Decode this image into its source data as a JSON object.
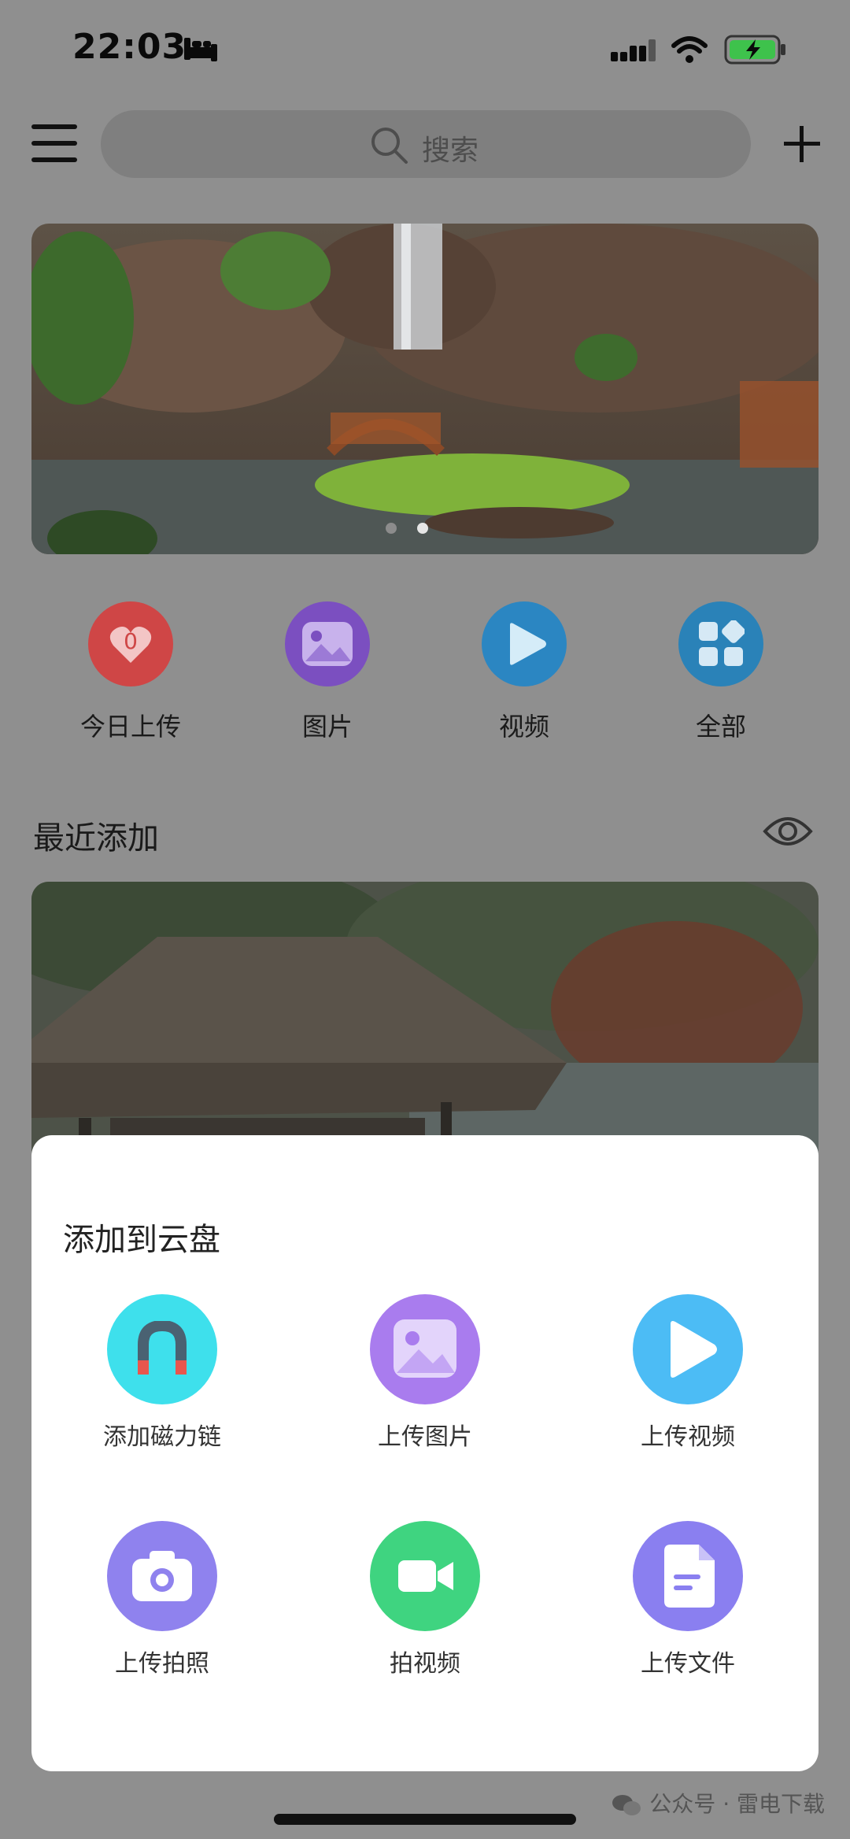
{
  "status_bar": {
    "time": "22:03"
  },
  "header": {
    "menu_icon": "hamburger-menu-icon",
    "search_placeholder": "搜索",
    "add_icon": "plus-icon"
  },
  "banner": {
    "page_count": 2,
    "active_page": 2
  },
  "categories": [
    {
      "label": "今日上传",
      "count": "0",
      "icon": "heart-upload-icon",
      "color": "#e04a4a"
    },
    {
      "label": "图片",
      "icon": "image-icon",
      "color": "#8a57d6"
    },
    {
      "label": "视频",
      "icon": "play-icon",
      "color": "#2d8fd1"
    },
    {
      "label": "全部",
      "icon": "grid-icon",
      "color": "#2c8fca"
    }
  ],
  "recent": {
    "title": "最近添加",
    "toggle_icon": "eye-icon"
  },
  "sheet": {
    "title": "添加到云盘",
    "actions": [
      {
        "label": "添加磁力链",
        "icon": "magnet-icon"
      },
      {
        "label": "上传图片",
        "icon": "image-icon"
      },
      {
        "label": "上传视频",
        "icon": "play-icon"
      },
      {
        "label": "上传拍照",
        "icon": "camera-icon"
      },
      {
        "label": "拍视频",
        "icon": "video-camera-icon"
      },
      {
        "label": "上传文件",
        "icon": "document-icon"
      }
    ]
  },
  "watermark": "公众号 · 雷电下载"
}
